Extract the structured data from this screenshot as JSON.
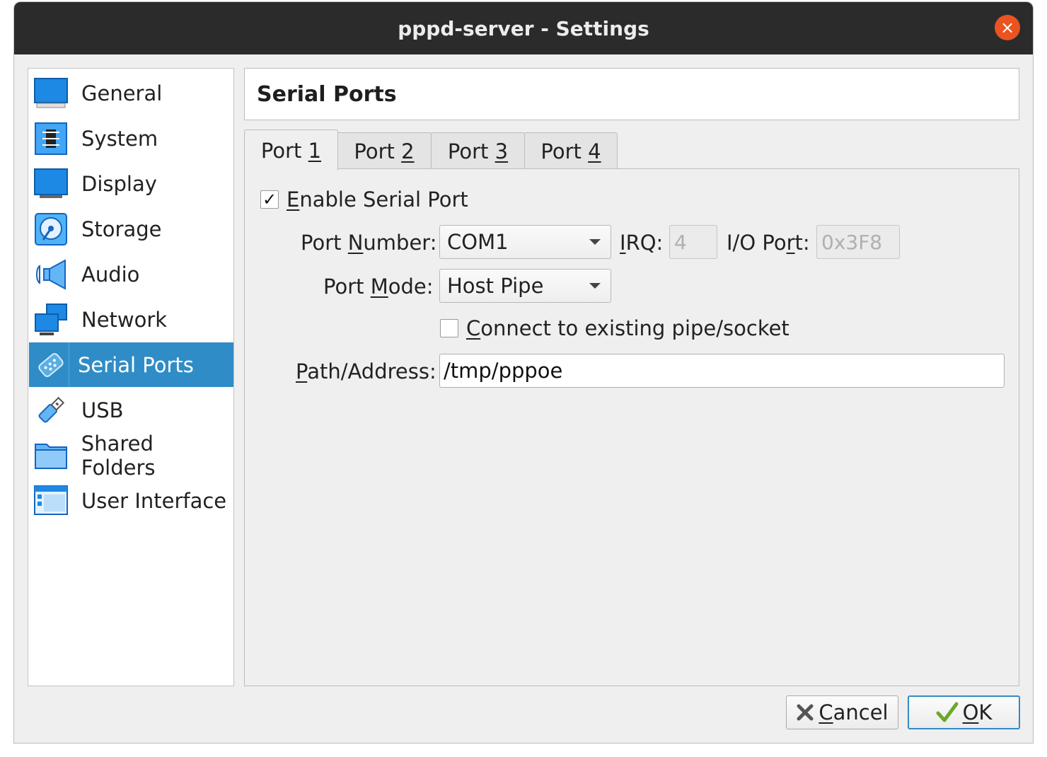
{
  "window": {
    "title": "pppd-server - Settings",
    "close_icon": "×"
  },
  "sidebar": {
    "items": [
      {
        "label": "General",
        "icon": "monitor-icon"
      },
      {
        "label": "System",
        "icon": "chip-icon"
      },
      {
        "label": "Display",
        "icon": "display-icon"
      },
      {
        "label": "Storage",
        "icon": "disk-icon"
      },
      {
        "label": "Audio",
        "icon": "speaker-icon"
      },
      {
        "label": "Network",
        "icon": "network-icon"
      },
      {
        "label": "Serial Ports",
        "icon": "serial-port-icon",
        "selected": true
      },
      {
        "label": "USB",
        "icon": "usb-icon"
      },
      {
        "label": "Shared Folders",
        "icon": "folder-icon"
      },
      {
        "label": "User Interface",
        "icon": "window-icon"
      }
    ]
  },
  "header": {
    "title": "Serial Ports"
  },
  "tabs": [
    {
      "prefix": "Port ",
      "mnemonic": "1",
      "active": true
    },
    {
      "prefix": "Port ",
      "mnemonic": "2"
    },
    {
      "prefix": "Port ",
      "mnemonic": "3"
    },
    {
      "prefix": "Port ",
      "mnemonic": "4"
    }
  ],
  "port": {
    "enable": {
      "checked": true,
      "check_glyph": "✓",
      "mnemonic": "E",
      "rest": "nable Serial Port"
    },
    "port_number": {
      "label_pre": "Port ",
      "mnemonic": "N",
      "label_post": "umber:",
      "value": "COM1"
    },
    "irq": {
      "mnemonic": "I",
      "label_post": "RQ:",
      "value": "4"
    },
    "io_port": {
      "label_pre": "I/O Po",
      "mnemonic": "r",
      "label_post": "t:",
      "value": "0x3F8"
    },
    "port_mode": {
      "label_pre": "Port ",
      "mnemonic": "M",
      "label_post": "ode:",
      "value": "Host Pipe"
    },
    "connect": {
      "checked": false,
      "mnemonic": "C",
      "rest": "onnect to existing pipe/socket"
    },
    "path": {
      "mnemonic": "P",
      "label_post": "ath/Address:",
      "value": "/tmp/pppoe"
    }
  },
  "buttons": {
    "cancel": {
      "mnemonic": "C",
      "rest": "ancel"
    },
    "ok": {
      "mnemonic": "O",
      "rest": "K"
    }
  },
  "colors": {
    "titlebar": "#2b2b2b",
    "close": "#e95420",
    "selection": "#308cc6",
    "icon_blue": "#1e88e5"
  }
}
